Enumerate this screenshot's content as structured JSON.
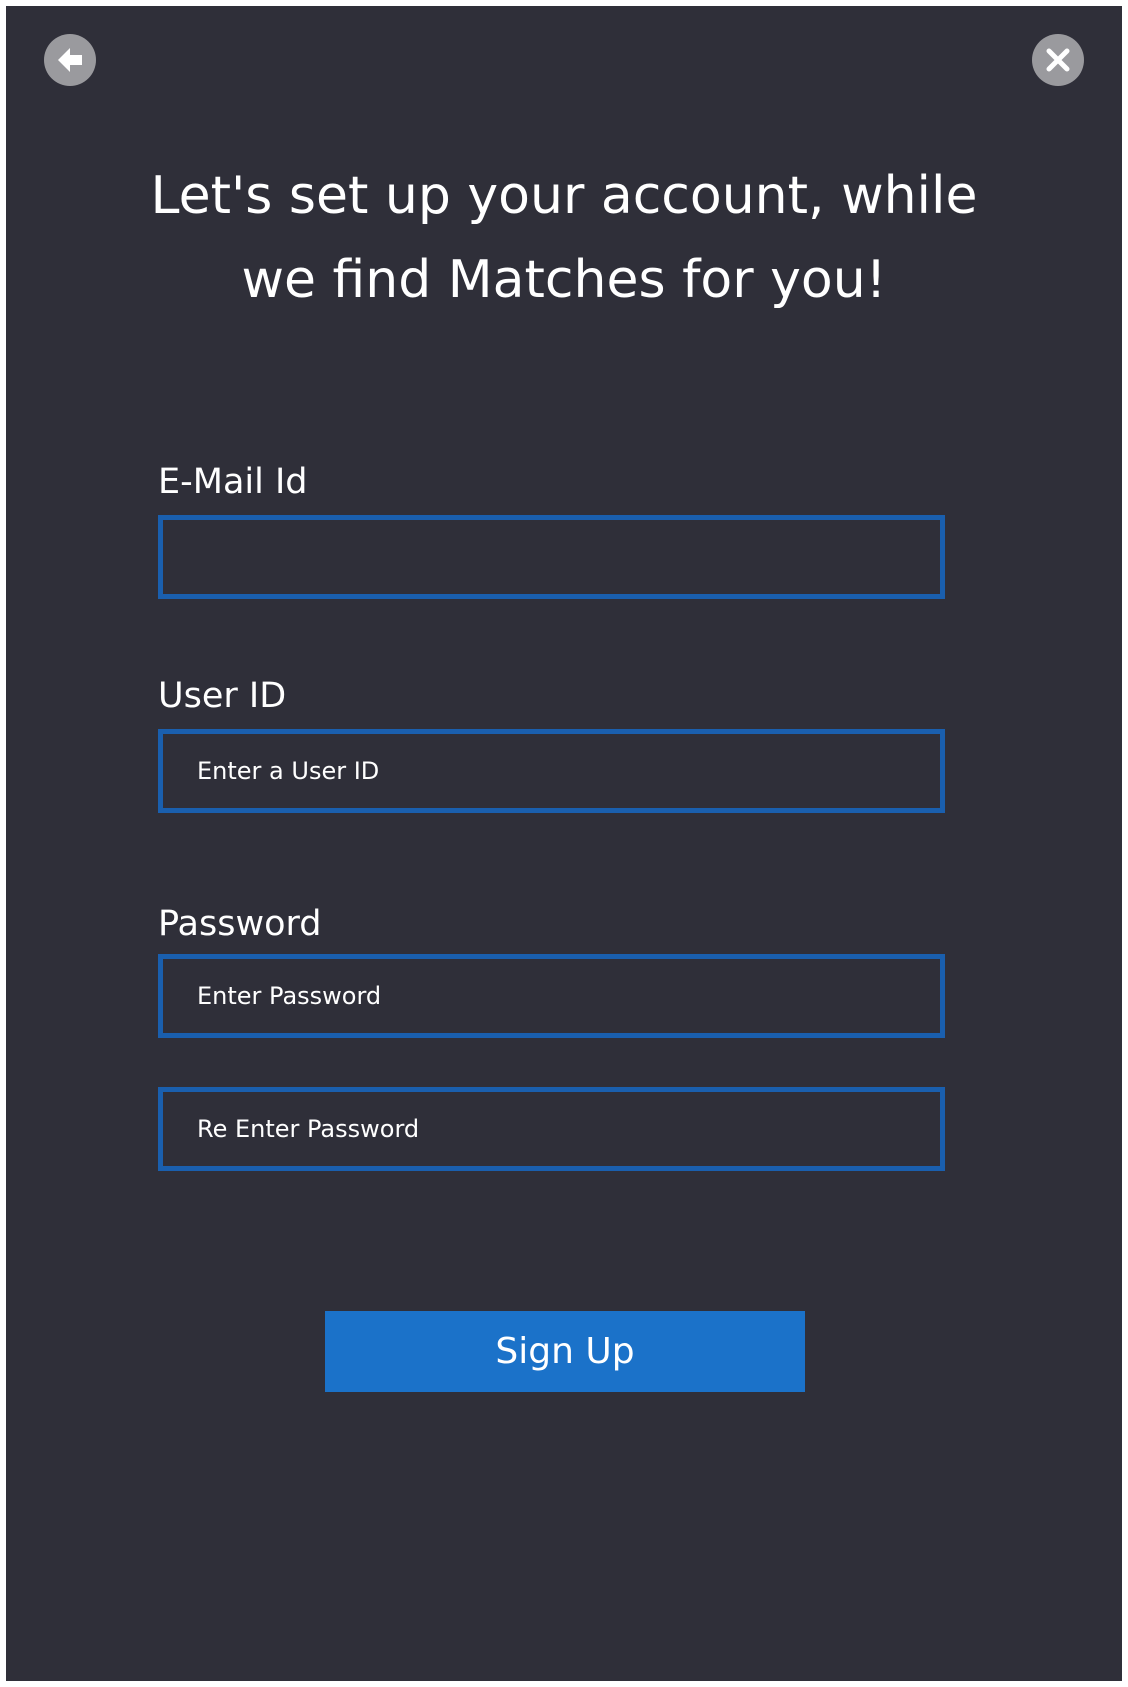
{
  "header": {
    "back_icon": "back-arrow-icon",
    "close_icon": "close-icon",
    "title_line1": "Let's set up your account, while",
    "title_line2": "we find Matches for you!"
  },
  "form": {
    "email": {
      "label": "E-Mail Id",
      "value": "",
      "placeholder": ""
    },
    "user_id": {
      "label": "User ID",
      "value": "",
      "placeholder": "Enter a User ID"
    },
    "password": {
      "label": "Password",
      "value": "",
      "placeholder": "Enter Password"
    },
    "reenter_password": {
      "value": "",
      "placeholder": "Re Enter Password"
    },
    "submit_label": "Sign Up"
  },
  "colors": {
    "background": "#2f2f39",
    "input_border": "#1a5fae",
    "button": "#1b72c9",
    "icon_circle": "#9a9a9e",
    "text": "#ffffff"
  }
}
